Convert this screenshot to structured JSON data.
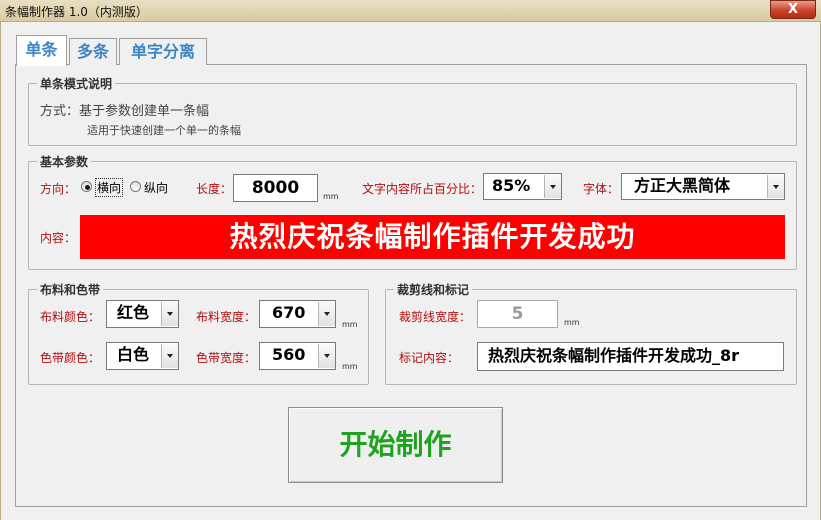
{
  "window": {
    "title": "条幅制作器 1.0（内测版）",
    "close_glyph": "X"
  },
  "tabs": [
    {
      "label": "单条",
      "active": true
    },
    {
      "label": "多条",
      "active": false
    },
    {
      "label": "单字分离",
      "active": false
    }
  ],
  "description": {
    "legend": "单条模式说明",
    "line1": "方式：基于参数创建单一条幅",
    "line2": "适用于快速创建一个单一的条幅"
  },
  "basic": {
    "legend": "基本参数",
    "direction_label": "方向：",
    "direction_options": [
      {
        "label": "横向",
        "selected": true
      },
      {
        "label": "纵向",
        "selected": false
      }
    ],
    "length_label": "长度：",
    "length_value": "8000",
    "length_unit": "mm",
    "ratio_label": "文字内容所占百分比：",
    "ratio_value": "85%",
    "font_label": "字体：",
    "font_value": "方正大黑简体",
    "content_label": "内容：",
    "content_value": "热烈庆祝条幅制作插件开发成功",
    "content_bg": "#ff0000"
  },
  "fabric": {
    "legend": "布料和色带",
    "fabric_color_label": "布料颜色：",
    "fabric_color_value": "红色",
    "fabric_width_label": "布料宽度：",
    "fabric_width_value": "670",
    "fabric_width_unit": "mm",
    "ribbon_color_label": "色带颜色：",
    "ribbon_color_value": "白色",
    "ribbon_width_label": "色带宽度：",
    "ribbon_width_value": "560",
    "ribbon_width_unit": "mm"
  },
  "crop": {
    "legend": "裁剪线和标记",
    "crop_width_label": "裁剪线宽度：",
    "crop_width_value": "5",
    "crop_width_unit": "mm",
    "mark_label": "标记内容：",
    "mark_value": "热烈庆祝条幅制作插件开发成功_8r"
  },
  "start_button": {
    "label": "开始制作",
    "color": "#1fa21f"
  },
  "colors": {
    "tab_text": "#3d86c5",
    "label_red": "#b10f0f"
  }
}
